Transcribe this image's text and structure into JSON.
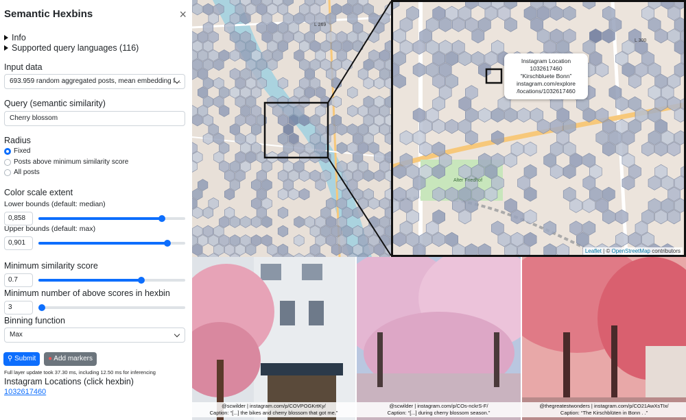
{
  "sidebar": {
    "title": "Semantic Hexbins",
    "close_glyph": "×",
    "info_label": "Info",
    "languages_label": "Supported query languages (116)",
    "input_data_label": "Input data",
    "input_data_value": "693.959 random aggregated posts, mean embedding f...",
    "query_label": "Query (semantic similarity)",
    "query_value": "Cherry blossom",
    "radius_label": "Radius",
    "radius_options": [
      "Fixed",
      "Posts above minimum similarity score",
      "All posts"
    ],
    "radius_selected": 0,
    "color_scale_label": "Color scale extent",
    "lower_bounds_label": "Lower bounds (default: median)",
    "lower_bounds_value": "0,858",
    "lower_slider_fraction": 0.84,
    "upper_bounds_label": "Upper bounds (default: max)",
    "upper_bounds_value": "0,901",
    "upper_slider_fraction": 0.88,
    "min_similarity_label": "Minimum similarity score",
    "min_similarity_value": "0.7",
    "min_similarity_fraction": 0.7,
    "min_count_label": "Minimum number of above scores in hexbin",
    "min_count_value": "3",
    "min_count_fraction": 0.0,
    "binning_label": "Binning function",
    "binning_value": "Max",
    "submit_label": "Submit",
    "add_markers_label": "Add markers",
    "status_text": "Full layer update took 37.30 ms, including 12.50 ms for inferencing",
    "locations_label": "Instagram Locations (click hexbin)",
    "location_link": "1032617460"
  },
  "map": {
    "road_label": "L 269",
    "road_label_2": "L 300",
    "district_label": "Alter Friedhof",
    "attribution_leaflet": "Leaflet",
    "attribution_sep": " | © ",
    "attribution_osm": "OpenStreetMap",
    "attribution_suffix": " contributors",
    "popup": {
      "line1": "Instagram Location",
      "line2": "1032617460",
      "line3": "“Kirschbluete Bonn”",
      "line4": "instagram.com/explore",
      "line5": "/locations/1032617460"
    }
  },
  "photos": [
    {
      "credit": "@scwilder  |  instagram.com/p/COVPOGKrtKy/",
      "caption": "Caption: “[...] the bikes and cherry blossom that got me.”"
    },
    {
      "credit": "@scwilder  |  instagram.com/p/COs-nckrS-F/",
      "caption": "Caption: “[...] during cherry blossom season.”"
    },
    {
      "credit": "@thegreatestwonders  |  instagram.com/p/CO21AwXsTIx/",
      "caption": "Caption: “The Kirschblüten in Bonn . .”"
    }
  ],
  "colors": {
    "accent": "#0d6efd",
    "hex_light": "#c9d0dd",
    "hex_dark": "#4a5a85",
    "river": "#aad3df"
  }
}
